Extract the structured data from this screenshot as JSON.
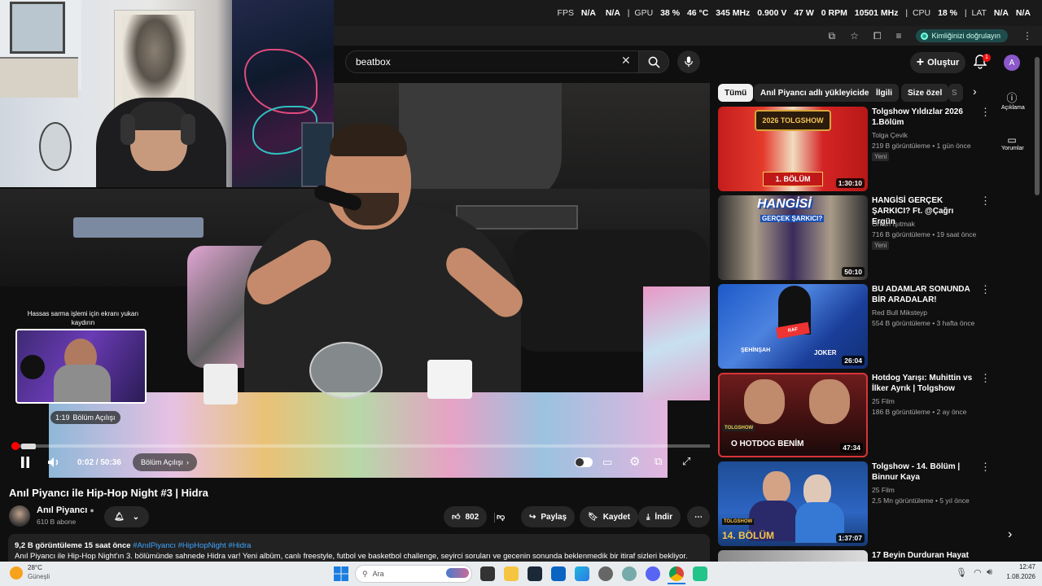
{
  "osd": {
    "fps_label": "FPS",
    "fps_val1": "N/A",
    "fps_val2": "N/A",
    "gpu_label": "GPU",
    "gpu_load": "38 %",
    "gpu_temp": "46 °C",
    "gpu_clock": "345 MHz",
    "gpu_volt": "0.900 V",
    "gpu_power": "47 W",
    "gpu_rpm": "0 RPM",
    "gpu_mem": "10501 MHz",
    "cpu_label": "CPU",
    "cpu_load": "18 %",
    "lat_label": "LAT",
    "lat_val": "N/A",
    "extra": "N/A"
  },
  "browser": {
    "verify_label": "Kimliğinizi doğrulayın"
  },
  "header": {
    "search_value": "beatbox",
    "create_label": "Oluştur",
    "notif_count": "1",
    "avatar_letter": "A"
  },
  "player": {
    "scroll_hint": "Hassas sarma işlemi için ekranı yukarı kaydırın",
    "preview_time": "1:19",
    "preview_chapter": "Bölüm Açılışı",
    "time": "0:02 / 50:36",
    "chapter": "Bölüm Açılışı",
    "progress_fraction": 0.001
  },
  "video": {
    "title": "Anıl Piyancı ile Hip-Hop Night #3 | Hidra",
    "channel": "Anıl Piyancı",
    "subs": "610 B abone",
    "likes": "802",
    "share": "Paylaş",
    "save": "Kaydet",
    "download": "İndir",
    "views_line": "9,2 B görüntüleme  15 saat önce",
    "hashtags": "#AnılPiyancı #HipHopNight #Hidra",
    "description": "Anıl Piyancı ile Hip-Hop Night'ın 3. bölümünde sahnede Hidra var! Yeni albüm, canlı freestyle, futbol ve basketbol challenge, seyirci soruları ve gecenin sonunda beklenmedik bir itiraf sizleri bekliyor."
  },
  "chips": [
    "Tümü",
    "Anıl Piyancı adlı yükleyiciden",
    "İlgili",
    "Size özel",
    "S"
  ],
  "side_rail": {
    "description": "Açıklama",
    "comments": "Yorumlar"
  },
  "recommendations": [
    {
      "title": "Tolgshow Yıldızlar 2026 1.Bölüm",
      "channel": "Tolga Çevik",
      "meta": "219 B görüntüleme • 1 gün önce",
      "badge": "Yeni",
      "duration": "1:30:10",
      "thumb_text": "1. BÖLÜM",
      "thumb_top": "2026 TOLGSHOW"
    },
    {
      "title": "HANGİSİ GERÇEK ŞARKICI? Ft. @Çağrı Ergün",
      "channel": "Orkun Işıtmak",
      "meta": "716 B görüntüleme • 19 saat önce",
      "badge": "Yeni",
      "duration": "50:10",
      "thumb_text": "HANGİSİ",
      "thumb_top": "GERÇEK ŞARKICI?"
    },
    {
      "title": "BU ADAMLAR SONUNDA BİR ARADALAR!",
      "channel": "Red Bull Miksteyp",
      "meta": "554 B görüntüleme • 3 hafta önce",
      "badge": "",
      "duration": "26:04",
      "thumb_text": "JOKER",
      "thumb_top": "ŞEHİNŞAH"
    },
    {
      "title": "Hotdog Yarışı: Muhittin vs İlker Ayrık | Tolgshow",
      "channel": "25 Film",
      "meta": "186 B görüntüleme • 2 ay önce",
      "badge": "",
      "duration": "47:34",
      "thumb_text": "O HOTDOG BENİM",
      "thumb_top": "TOLGSHOW"
    },
    {
      "title": "Tolgshow - 14. Bölüm | Binnur Kaya",
      "channel": "25 Film",
      "meta": "2,5 Mn görüntüleme • 5 yıl önce",
      "badge": "",
      "duration": "1:37:07",
      "thumb_text": "14. BÖLÜM",
      "thumb_top": "TOLGSHOW"
    },
    {
      "title": "17 Beyin Durduran Hayat",
      "channel": "",
      "meta": "",
      "badge": "",
      "duration": "",
      "thumb_text": "",
      "thumb_top": ""
    }
  ],
  "taskbar": {
    "weather_temp": "28°C",
    "weather_desc": "Güneşli",
    "search_label": "Ara",
    "time": "12:47",
    "date": "1.08.2026"
  }
}
